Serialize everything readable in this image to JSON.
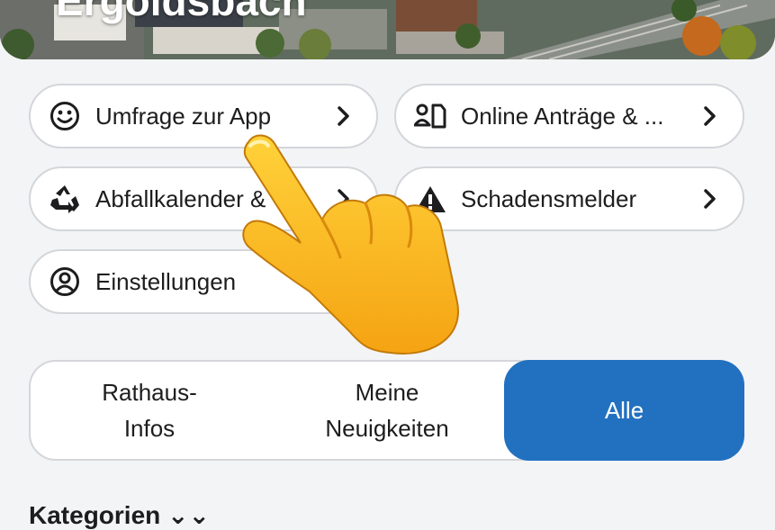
{
  "hero": {
    "title": "Ergoldsbach"
  },
  "tiles": [
    {
      "label": "Umfrage zur App",
      "icon": "smiley-icon"
    },
    {
      "label": "Online Anträge & ...",
      "icon": "person-form-icon"
    },
    {
      "label": "Abfallkalender &",
      "icon": "recycle-icon"
    },
    {
      "label": "Schadensmelder",
      "icon": "warning-icon"
    },
    {
      "label": "Einstellungen",
      "icon": "account-circle-icon"
    }
  ],
  "segments": {
    "rathaus_line1": "Rathaus-",
    "rathaus_line2": "Infos",
    "meine_line1": "Meine",
    "meine_line2": "Neuigkeiten",
    "alle": "Alle",
    "active_color": "#2271c0"
  },
  "categories": {
    "label": "Kategorien ⌄⌄"
  },
  "overlay": {
    "icon": "pointing-hand-icon"
  }
}
